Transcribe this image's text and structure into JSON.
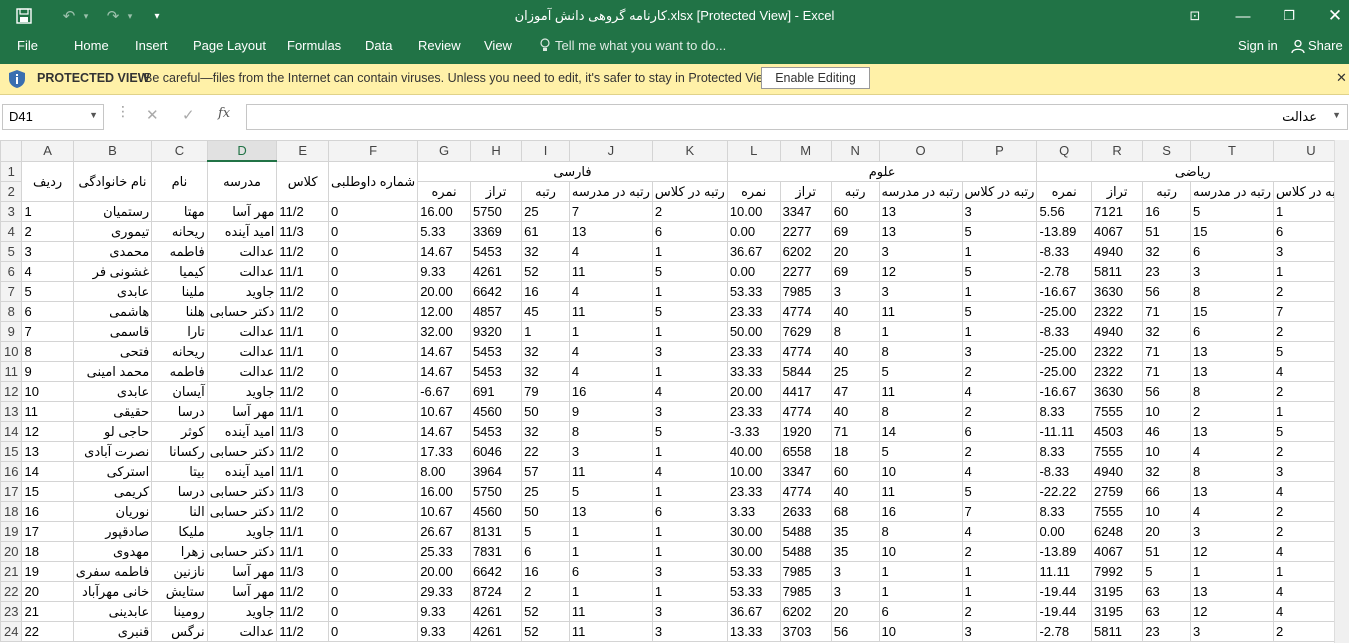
{
  "titlebar": {
    "title": "کارنامه گروهی دانش آموزان.xlsx  [Protected View] - Excel"
  },
  "ribbon": {
    "tabs": [
      "File",
      "Home",
      "Insert",
      "Page Layout",
      "Formulas",
      "Data",
      "Review",
      "View"
    ],
    "tell_me": "Tell me what you want to do...",
    "sign_in": "Sign in",
    "share": "Share"
  },
  "protected": {
    "label": "PROTECTED VIEW",
    "message": "Be careful—files from the Internet can contain viruses. Unless you need to edit, it's safer to stay in Protected View.",
    "button": "Enable Editing"
  },
  "formula": {
    "name_box": "D41",
    "value": "عدالت",
    "fx": "fx"
  },
  "columns": [
    "A",
    "B",
    "C",
    "D",
    "E",
    "F",
    "G",
    "H",
    "I",
    "J",
    "K",
    "L",
    "M",
    "N",
    "O",
    "P",
    "Q",
    "R",
    "S",
    "T",
    "U"
  ],
  "groups": [
    "فارسی",
    "علوم",
    "ریاضی"
  ],
  "headers_row1": {
    "A": "ردیف",
    "B": "نام خانوادگی",
    "C": "نام",
    "D": "مدرسه",
    "E": "کلاس",
    "F": "شماره داوطلبی"
  },
  "headers_row2": [
    "نمره",
    "تراز",
    "رتبه",
    "رتبه در مدرسه",
    "رتبه در کلاس",
    "نمره",
    "تراز",
    "رتبه",
    "رتبه در مدرسه",
    "رتبه در کلاس",
    "نمره",
    "تراز",
    "رتبه",
    "رتبه در مدرسه",
    "رتبه در کلاس"
  ],
  "rows": [
    [
      "1",
      "رستمیان",
      "مهتا",
      "مهر آسا",
      "11/2",
      "0",
      "16.00",
      "5750",
      "25",
      "7",
      "2",
      "10.00",
      "3347",
      "60",
      "13",
      "3",
      "5.56",
      "7121",
      "16",
      "5",
      "1"
    ],
    [
      "2",
      "تیموری",
      "ریحانه",
      "امید آینده",
      "11/3",
      "0",
      "5.33",
      "3369",
      "61",
      "13",
      "6",
      "0.00",
      "2277",
      "69",
      "13",
      "5",
      "-13.89",
      "4067",
      "51",
      "15",
      "6"
    ],
    [
      "3",
      "محمدی",
      "فاطمه",
      "عدالت",
      "11/2",
      "0",
      "14.67",
      "5453",
      "32",
      "4",
      "1",
      "36.67",
      "6202",
      "20",
      "3",
      "1",
      "-8.33",
      "4940",
      "32",
      "6",
      "3"
    ],
    [
      "4",
      "غشونی فر",
      "کیمیا",
      "عدالت",
      "11/1",
      "0",
      "9.33",
      "4261",
      "52",
      "11",
      "5",
      "0.00",
      "2277",
      "69",
      "12",
      "5",
      "-2.78",
      "5811",
      "23",
      "3",
      "1"
    ],
    [
      "5",
      "عابدی",
      "ملینا",
      "جاوید",
      "11/2",
      "0",
      "20.00",
      "6642",
      "16",
      "4",
      "1",
      "53.33",
      "7985",
      "3",
      "3",
      "1",
      "-16.67",
      "3630",
      "56",
      "8",
      "2"
    ],
    [
      "6",
      "هاشمی",
      "هلنا",
      "دکتر حسابی",
      "11/2",
      "0",
      "12.00",
      "4857",
      "45",
      "11",
      "5",
      "23.33",
      "4774",
      "40",
      "11",
      "5",
      "-25.00",
      "2322",
      "71",
      "15",
      "7"
    ],
    [
      "7",
      "قاسمی",
      "تارا",
      "عدالت",
      "11/1",
      "0",
      "32.00",
      "9320",
      "1",
      "1",
      "1",
      "50.00",
      "7629",
      "8",
      "1",
      "1",
      "-8.33",
      "4940",
      "32",
      "6",
      "2"
    ],
    [
      "8",
      "فتحی",
      "ریحانه",
      "عدالت",
      "11/1",
      "0",
      "14.67",
      "5453",
      "32",
      "4",
      "3",
      "23.33",
      "4774",
      "40",
      "8",
      "3",
      "-25.00",
      "2322",
      "71",
      "13",
      "5"
    ],
    [
      "9",
      "محمد امینی",
      "فاطمه",
      "عدالت",
      "11/2",
      "0",
      "14.67",
      "5453",
      "32",
      "4",
      "1",
      "33.33",
      "5844",
      "25",
      "5",
      "2",
      "-25.00",
      "2322",
      "71",
      "13",
      "4"
    ],
    [
      "10",
      "عابدی",
      "آیسان",
      "جاوید",
      "11/2",
      "0",
      "-6.67",
      "691",
      "79",
      "16",
      "4",
      "20.00",
      "4417",
      "47",
      "11",
      "4",
      "-16.67",
      "3630",
      "56",
      "8",
      "2"
    ],
    [
      "11",
      "حقیقی",
      "درسا",
      "مهر آسا",
      "11/1",
      "0",
      "10.67",
      "4560",
      "50",
      "9",
      "3",
      "23.33",
      "4774",
      "40",
      "8",
      "2",
      "8.33",
      "7555",
      "10",
      "2",
      "1"
    ],
    [
      "12",
      "حاجی لو",
      "کوثر",
      "امید آینده",
      "11/3",
      "0",
      "14.67",
      "5453",
      "32",
      "8",
      "5",
      "-3.33",
      "1920",
      "71",
      "14",
      "6",
      "-11.11",
      "4503",
      "46",
      "13",
      "5"
    ],
    [
      "13",
      "نصرت آبادی",
      "رکسانا",
      "دکتر حسابی",
      "11/2",
      "0",
      "17.33",
      "6046",
      "22",
      "3",
      "1",
      "40.00",
      "6558",
      "18",
      "5",
      "2",
      "8.33",
      "7555",
      "10",
      "4",
      "2"
    ],
    [
      "14",
      "استرکی",
      "بیتا",
      "امید آینده",
      "11/1",
      "0",
      "8.00",
      "3964",
      "57",
      "11",
      "4",
      "10.00",
      "3347",
      "60",
      "10",
      "4",
      "-8.33",
      "4940",
      "32",
      "8",
      "3"
    ],
    [
      "15",
      "کریمی",
      "درسا",
      "دکتر حسابی",
      "11/3",
      "0",
      "16.00",
      "5750",
      "25",
      "5",
      "1",
      "23.33",
      "4774",
      "40",
      "11",
      "5",
      "-22.22",
      "2759",
      "66",
      "13",
      "4"
    ],
    [
      "16",
      "نوریان",
      "النا",
      "دکتر حسابی",
      "11/2",
      "0",
      "10.67",
      "4560",
      "50",
      "13",
      "6",
      "3.33",
      "2633",
      "68",
      "16",
      "7",
      "8.33",
      "7555",
      "10",
      "4",
      "2"
    ],
    [
      "17",
      "صادقپور",
      "ملیکا",
      "جاوید",
      "11/1",
      "0",
      "26.67",
      "8131",
      "5",
      "1",
      "1",
      "30.00",
      "5488",
      "35",
      "8",
      "4",
      "0.00",
      "6248",
      "20",
      "3",
      "2"
    ],
    [
      "18",
      "مهدوی",
      "زهرا",
      "دکتر حسابی",
      "11/1",
      "0",
      "25.33",
      "7831",
      "6",
      "1",
      "1",
      "30.00",
      "5488",
      "35",
      "10",
      "2",
      "-13.89",
      "4067",
      "51",
      "12",
      "4"
    ],
    [
      "19",
      "فاطمه سفری",
      "نازنین",
      "مهر آسا",
      "11/3",
      "0",
      "20.00",
      "6642",
      "16",
      "6",
      "3",
      "53.33",
      "7985",
      "3",
      "1",
      "1",
      "11.11",
      "7992",
      "5",
      "1",
      "1"
    ],
    [
      "20",
      "خانی مهرآباد",
      "ستایش",
      "مهر آسا",
      "11/2",
      "0",
      "29.33",
      "8724",
      "2",
      "1",
      "1",
      "53.33",
      "7985",
      "3",
      "1",
      "1",
      "-19.44",
      "3195",
      "63",
      "13",
      "4"
    ],
    [
      "21",
      "عابدینی",
      "رومینا",
      "جاوید",
      "11/2",
      "0",
      "9.33",
      "4261",
      "52",
      "11",
      "3",
      "36.67",
      "6202",
      "20",
      "6",
      "2",
      "-19.44",
      "3195",
      "63",
      "12",
      "4"
    ],
    [
      "22",
      "قنبری",
      "نرگس",
      "عدالت",
      "11/2",
      "0",
      "9.33",
      "4261",
      "52",
      "11",
      "3",
      "13.33",
      "3703",
      "56",
      "10",
      "3",
      "-2.78",
      "5811",
      "23",
      "3",
      "2"
    ]
  ]
}
